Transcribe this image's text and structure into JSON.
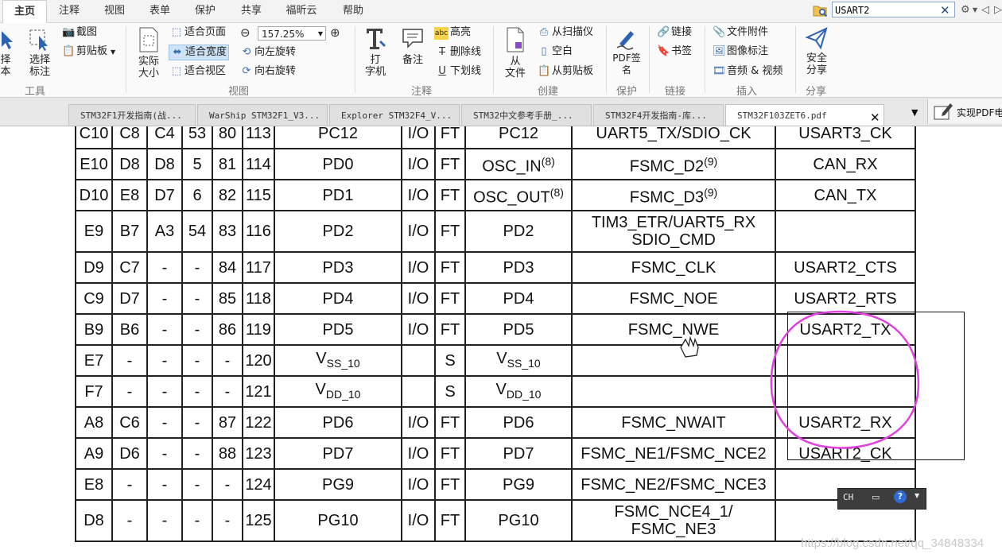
{
  "menu": {
    "tabs": [
      "主页",
      "注释",
      "视图",
      "表单",
      "保护",
      "共享",
      "福昕云",
      "帮助"
    ],
    "active_index": 0
  },
  "search": {
    "value": "USART2",
    "close_glyph": "✕",
    "settings_glyph": "⚙",
    "prev_glyph": "◁",
    "next_glyph": "▷"
  },
  "ribbon": {
    "tools": {
      "select_text": "择\n本",
      "select_annotation": "选择\n标注",
      "screenshot": "截图",
      "clipboard": "剪贴板",
      "group_label": "工具"
    },
    "view": {
      "actual_size": "实际\n大小",
      "fit_page": "适合页面",
      "fit_width": "适合宽度",
      "fit_visible": "适合视区",
      "zoom_value": "157.25%",
      "rotate_left": "向左旋转",
      "rotate_right": "向右旋转",
      "group_label": "视图"
    },
    "comment": {
      "typewriter": "打\n字机",
      "note": "备注",
      "highlight": "高亮",
      "strikeout": "删除线",
      "underline": "下划线",
      "group_label": "注释"
    },
    "create": {
      "from_file": "从\n文件",
      "from_scanner": "从扫描仪",
      "blank": "空白",
      "from_clipboard": "从剪贴板",
      "group_label": "创建"
    },
    "protect": {
      "pdf_sign": "PDF签\n名",
      "group_label": "保护"
    },
    "links": {
      "link": "链接",
      "bookmark": "书签",
      "group_label": "链接"
    },
    "insert": {
      "file_attachment": "文件附件",
      "image_annotation": "图像标注",
      "audio_video": "音频 & 视频",
      "group_label": "插入"
    },
    "share": {
      "secure_share": "安全\n分享",
      "group_label": "分享"
    }
  },
  "doc_tabs": [
    {
      "label": "STM32F1开发指南(战..."
    },
    {
      "label": "WarShip STM32F1_V3..."
    },
    {
      "label": "Explorer STM32F4_V..."
    },
    {
      "label": "STM32中文参考手册_..."
    },
    {
      "label": "STM32F4开发指南-库..."
    },
    {
      "label": "STM32F103ZET6.pdf"
    }
  ],
  "active_doc_tab": 5,
  "tab_close_glyph": "✕",
  "realize_button_label": "实现PDF电",
  "pin_table": {
    "rows": [
      {
        "c": [
          "C10",
          "C8",
          "C4",
          "53",
          "80",
          "113",
          "PC12",
          "I/O",
          "FT",
          "PC12",
          "UART5_TX/SDIO_CK",
          "USART3_CK"
        ]
      },
      {
        "c": [
          "E10",
          "D8",
          "D8",
          "5",
          "81",
          "114",
          "PD0",
          "I/O",
          "FT",
          "OSC_IN",
          "FSMC_D2",
          "CAN_RX"
        ],
        "sup9": "(8)",
        "sup10": "(9)"
      },
      {
        "c": [
          "D10",
          "E8",
          "D7",
          "6",
          "82",
          "115",
          "PD1",
          "I/O",
          "FT",
          "OSC_OUT",
          "FSMC_D3",
          "CAN_TX"
        ],
        "sup9": "(8)",
        "sup10": "(9)"
      },
      {
        "c": [
          "E9",
          "B7",
          "A3",
          "54",
          "83",
          "116",
          "PD2",
          "I/O",
          "FT",
          "PD2",
          "TIM3_ETR/UART5_RX",
          "SDIO_CMD",
          ""
        ],
        "tall": true,
        "two_line": true
      },
      {
        "c": [
          "D9",
          "C7",
          "-",
          "-",
          "84",
          "117",
          "PD3",
          "I/O",
          "FT",
          "PD3",
          "FSMC_CLK",
          "USART2_CTS"
        ]
      },
      {
        "c": [
          "C9",
          "D7",
          "-",
          "-",
          "85",
          "118",
          "PD4",
          "I/O",
          "FT",
          "PD4",
          "FSMC_NOE",
          "USART2_RTS"
        ]
      },
      {
        "c": [
          "B9",
          "B6",
          "-",
          "-",
          "86",
          "119",
          "PD5",
          "I/O",
          "FT",
          "PD5",
          "FSMC_NWE",
          "USART2_TX"
        ]
      },
      {
        "c": [
          "E7",
          "-",
          "-",
          "-",
          "-",
          "120",
          "V",
          "",
          "S",
          "",
          "V",
          "",
          ""
        ],
        "supply": true,
        "sub6": "SS_10",
        "sub9": "SS_10"
      },
      {
        "c": [
          "F7",
          "-",
          "-",
          "-",
          "-",
          "121",
          "V",
          "",
          "S",
          "",
          "V",
          "",
          ""
        ],
        "supply": true,
        "sub6": "DD_10",
        "sub9": "DD_10"
      },
      {
        "c": [
          "A8",
          "C6",
          "-",
          "-",
          "87",
          "122",
          "PD6",
          "I/O",
          "FT",
          "PD6",
          "FSMC_NWAIT",
          "USART2_RX"
        ]
      },
      {
        "c": [
          "A9",
          "D6",
          "-",
          "-",
          "88",
          "123",
          "PD7",
          "I/O",
          "FT",
          "PD7",
          "FSMC_NE1/FSMC_NCE2",
          "USART2_CK"
        ]
      },
      {
        "c": [
          "E8",
          "-",
          "-",
          "-",
          "-",
          "124",
          "PG9",
          "I/O",
          "FT",
          "PG9",
          "FSMC_NE2/FSMC_NCE3",
          ""
        ]
      },
      {
        "c": [
          "D8",
          "-",
          "-",
          "-",
          "-",
          "125",
          "PG10",
          "I/O",
          "FT",
          "PG10",
          "FSMC_NCE4_1/",
          "FSMC_NE3",
          ""
        ],
        "tall": true,
        "two_line": true
      }
    ]
  },
  "ime": {
    "label": "CH",
    "help": "?"
  },
  "watermark": "https://blog.csdn.net/qq_34848334",
  "colors": {
    "annotation_circle": "#e040e0",
    "accent": "#3a6fb0"
  }
}
